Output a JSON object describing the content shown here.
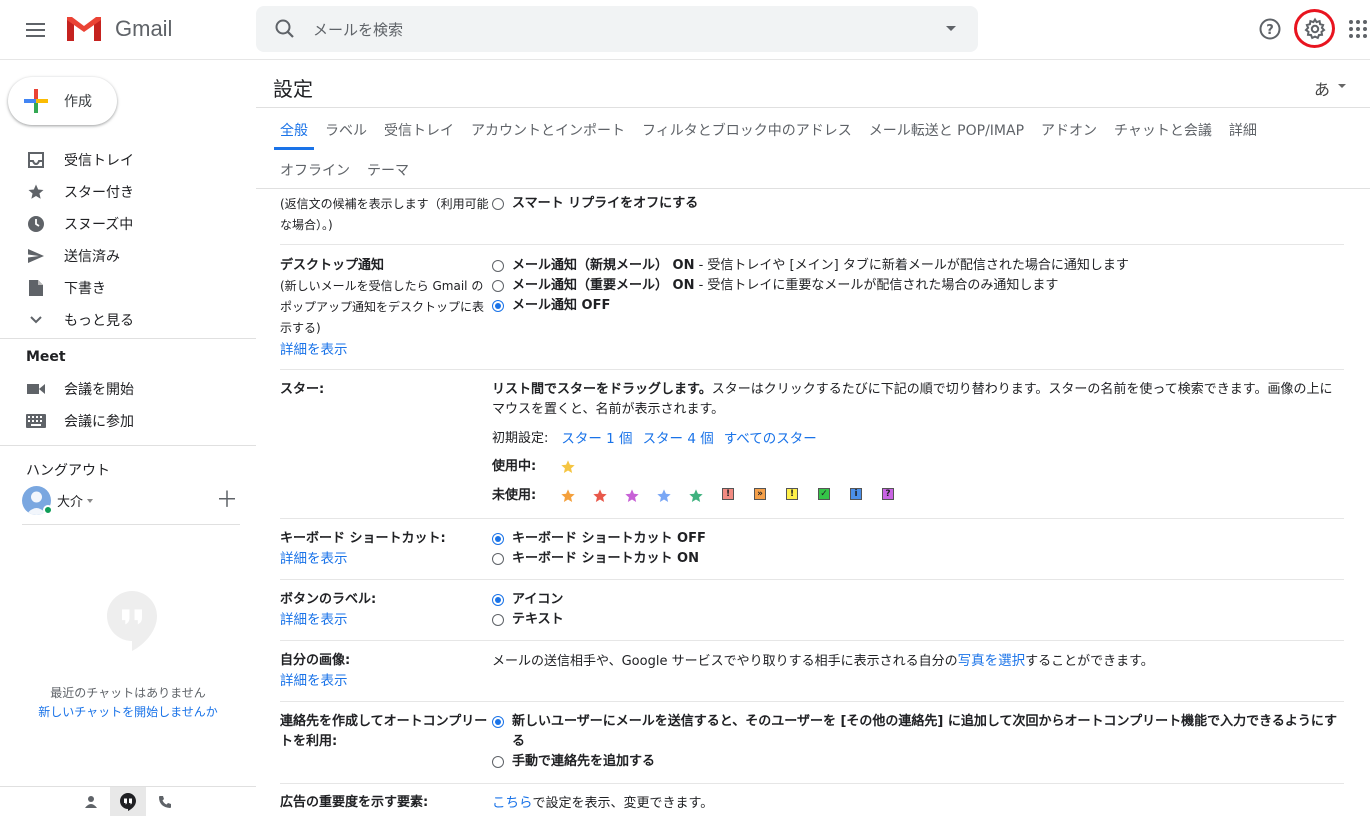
{
  "app": {
    "name": "Gmail"
  },
  "search": {
    "placeholder": "メールを検索"
  },
  "colors": {
    "accent": "#1a73e8",
    "highlight_circle": "#e8141f"
  },
  "icons": {
    "menu": "hamburger-icon",
    "search": "search-icon",
    "help": "help-icon",
    "settings": "gear-icon",
    "apps": "apps-grid-icon"
  },
  "compose": {
    "label": "作成"
  },
  "nav": [
    {
      "label": "受信トレイ",
      "icon": "inbox-icon"
    },
    {
      "label": "スター付き",
      "icon": "star-icon"
    },
    {
      "label": "スヌーズ中",
      "icon": "clock-icon"
    },
    {
      "label": "送信済み",
      "icon": "send-icon"
    },
    {
      "label": "下書き",
      "icon": "draft-icon"
    },
    {
      "label": "もっと見る",
      "icon": "chevron-down-icon"
    }
  ],
  "meet": {
    "heading": "Meet",
    "items": [
      {
        "label": "会議を開始",
        "icon": "video-icon"
      },
      {
        "label": "会議に参加",
        "icon": "keyboard-icon"
      }
    ]
  },
  "hangouts": {
    "heading": "ハングアウト",
    "user": "大介",
    "no_chats": "最近のチャットはありません",
    "start_chat": "新しいチャットを開始しませんか"
  },
  "page": {
    "title": "設定",
    "lang": "あ"
  },
  "tabs": {
    "row1": [
      "全般",
      "ラベル",
      "受信トレイ",
      "アカウントとインポート",
      "フィルタとブロック中のアドレス",
      "メール転送と POP/IMAP",
      "アドオン",
      "チャットと会議",
      "詳細"
    ],
    "row2": [
      "オフライン",
      "テーマ"
    ]
  },
  "settings": {
    "smart_reply": {
      "desc": "(返信文の候補を表示します（利用可能な場合）。)",
      "option_off": "スマート リプライをオフにする"
    },
    "desktop": {
      "label": "デスクトップ通知",
      "desc": "(新しいメールを受信したら Gmail のポップアップ通知をデスクトップに表示する)",
      "more": "詳細を表示",
      "opt1_bold": "メール通知（新規メール） ON",
      "opt1_rest": " - 受信トレイや [メイン] タブに新着メールが配信された場合に通知します",
      "opt2_bold": "メール通知（重要メール） ON",
      "opt2_rest": " - 受信トレイに重要なメールが配信された場合のみ通知します",
      "opt3_bold": "メール通知 OFF"
    },
    "stars": {
      "label": "スター:",
      "desc_bold": "リスト間でスターをドラッグします。",
      "desc_rest": "スターはクリックするたびに下記の順で切り替わります。スターの名前を使って検索できます。画像の上にマウスを置くと、名前が表示されます。",
      "presets_label": "初期設定:",
      "preset1": "スター 1 個",
      "preset2": "スター 4 個",
      "preset3": "すべてのスター",
      "in_use": "使用中:",
      "not_in_use": "未使用:",
      "in_use_colors": [
        "#f5c542"
      ],
      "unused": [
        {
          "type": "star",
          "color": "#f4a03c"
        },
        {
          "type": "star",
          "color": "#e8584a"
        },
        {
          "type": "star",
          "color": "#c761d6"
        },
        {
          "type": "star",
          "color": "#7aa7f5"
        },
        {
          "type": "star",
          "color": "#3fb27f"
        },
        {
          "type": "box",
          "text": "!",
          "color": "#f28b82"
        },
        {
          "type": "box",
          "text": "»",
          "color": "#f5a04a"
        },
        {
          "type": "box",
          "text": "!",
          "color": "#fff04a"
        },
        {
          "type": "box",
          "text": "✓",
          "color": "#34c348"
        },
        {
          "type": "box",
          "text": "i",
          "color": "#4b8fe8"
        },
        {
          "type": "box",
          "text": "?",
          "color": "#c964e3"
        }
      ]
    },
    "keyboard": {
      "label": "キーボード ショートカット:",
      "more": "詳細を表示",
      "off": "キーボード ショートカット OFF",
      "on": "キーボード ショートカット ON"
    },
    "button_labels": {
      "label": "ボタンのラベル:",
      "more": "詳細を表示",
      "icons": "アイコン",
      "text": "テキスト"
    },
    "my_picture": {
      "label": "自分の画像:",
      "more": "詳細を表示",
      "text_before": "メールの送信相手や、Google サービスでやり取りする相手に表示される自分の",
      "link": "写真を選択",
      "text_after": "することができます。"
    },
    "autocomplete": {
      "label": "連絡先を作成してオートコンプリートを利用:",
      "opt1": "新しいユーザーにメールを送信すると、そのユーザーを [その他の連絡先] に追加して次回からオートコンプリート機能で入力できるようにする",
      "opt2": "手動で連絡先を追加する"
    },
    "ads": {
      "label": "広告の重要度を示す要素:",
      "link": "こちら",
      "text": "で設定を表示、変更できます。"
    }
  }
}
